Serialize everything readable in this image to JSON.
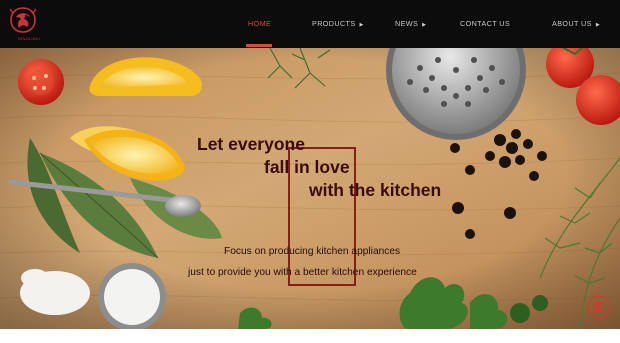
{
  "brand": {
    "logo_text": "DINGLINXI",
    "colors": {
      "accent": "#d64b3a",
      "nav_bg": "#0c0c0c",
      "headline": "#3b0b07",
      "frame": "#8a1f1a"
    }
  },
  "nav": {
    "items": [
      {
        "label": "HOME",
        "has_dropdown": false,
        "active": true
      },
      {
        "label": "PRODUCTS",
        "has_dropdown": true,
        "active": false
      },
      {
        "label": "NEWS",
        "has_dropdown": true,
        "active": false
      },
      {
        "label": "CONTACT US",
        "has_dropdown": false,
        "active": false
      },
      {
        "label": "ABOUT US",
        "has_dropdown": true,
        "active": false
      }
    ],
    "dropdown_icon": "caret-right-icon"
  },
  "hero": {
    "headline": [
      "Let everyone",
      "fall in love",
      "with the kitchen"
    ],
    "tagline": [
      "Focus on producing kitchen appliances",
      "just to provide you with a better kitchen experience"
    ],
    "background": "cutting board with lemon, tomatoes, bay leaves, spoon, salt, grater, peppercorns and dill"
  }
}
